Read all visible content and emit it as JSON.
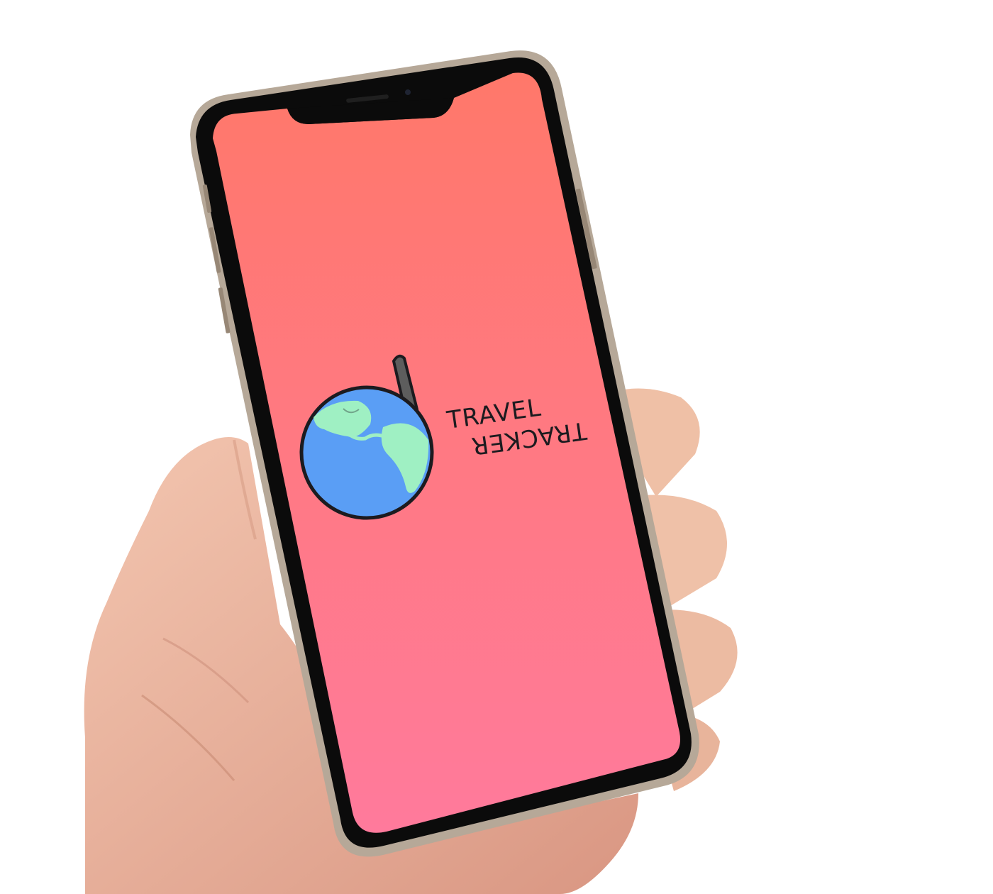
{
  "screen": {
    "name": "splash-screen",
    "gradient_top": "#ff7a6a",
    "gradient_bottom": "#ff7b9c"
  },
  "logo": {
    "line1": "TRAVEL",
    "line2": "TRACKER",
    "globe_ocean": "#5a9ef5",
    "globe_land": "#9ff0c3",
    "outline": "#1c1b1f",
    "icon_name": "globe-icon"
  },
  "device": {
    "frame_color": "#0b0b0b",
    "edge_color": "#b9aa98"
  }
}
